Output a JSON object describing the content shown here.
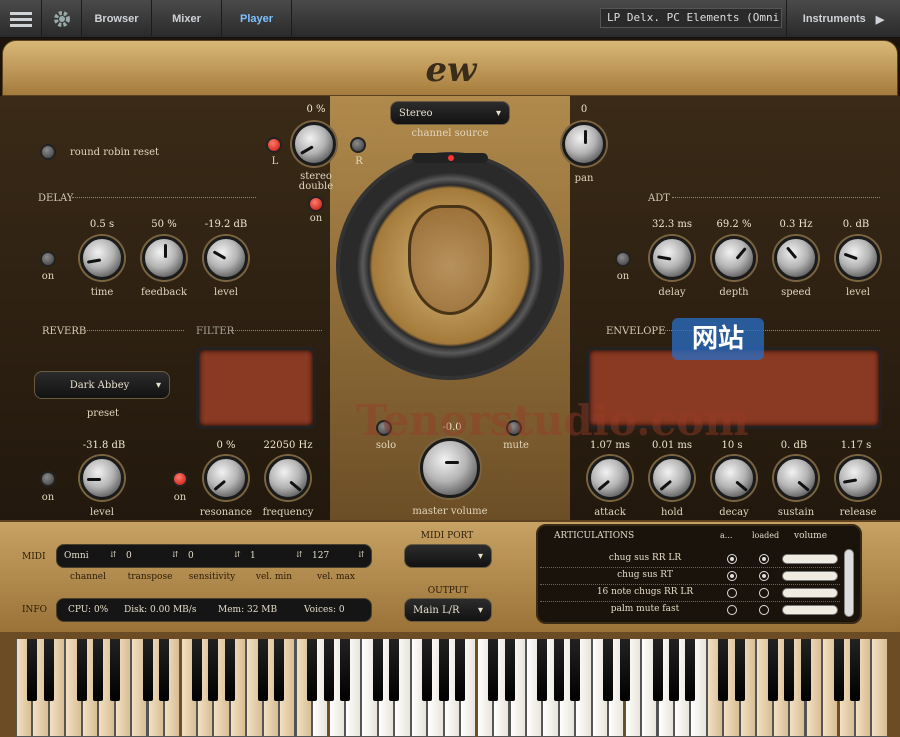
{
  "topbar": {
    "tabs": [
      "Browser",
      "Mixer",
      "Player"
    ],
    "active_tab": "Player",
    "preset": "LP Delx. PC Elements (Omni)",
    "instruments_label": "Instruments"
  },
  "brand": "ew",
  "round_robin": {
    "label": "round robin reset"
  },
  "stereo_double": {
    "value": "0 %",
    "label": "stereo double",
    "left": "L",
    "right": "R",
    "on_label": "on"
  },
  "channel_source": {
    "value": "Stereo",
    "label": "channel source"
  },
  "pan": {
    "value": "0",
    "label": "pan"
  },
  "delay": {
    "title": "DELAY",
    "on_label": "on",
    "knobs": [
      {
        "value": "0.5 s",
        "label": "time"
      },
      {
        "value": "50 %",
        "label": "feedback"
      },
      {
        "value": "-19.2 dB",
        "label": "level"
      }
    ]
  },
  "adt": {
    "title": "ADT",
    "on_label": "on",
    "knobs": [
      {
        "value": "32.3 ms",
        "label": "delay"
      },
      {
        "value": "69.2 %",
        "label": "depth"
      },
      {
        "value": "0.3 Hz",
        "label": "speed"
      },
      {
        "value": "0. dB",
        "label": "level"
      }
    ]
  },
  "reverb": {
    "title": "REVERB",
    "preset": "Dark Abbey",
    "preset_label": "preset",
    "value": "-31.8 dB",
    "label": "level",
    "on_label": "on"
  },
  "filter": {
    "title": "FILTER",
    "on_label": "on",
    "knobs": [
      {
        "value": "0 %",
        "label": "resonance"
      },
      {
        "value": "22050 Hz",
        "label": "frequency"
      }
    ]
  },
  "center": {
    "solo": "solo",
    "mute": "mute",
    "master_value": "-0.0",
    "master_label": "master volume"
  },
  "envelope": {
    "title": "ENVELOPE",
    "knobs": [
      {
        "value": "1.07 ms",
        "label": "attack"
      },
      {
        "value": "0.01 ms",
        "label": "hold"
      },
      {
        "value": "10 s",
        "label": "decay"
      },
      {
        "value": "0. dB",
        "label": "sustain"
      },
      {
        "value": "1.17 s",
        "label": "release"
      }
    ]
  },
  "midi": {
    "title": "MIDI",
    "fields": [
      {
        "value": "Omni",
        "label": "channel"
      },
      {
        "value": "0",
        "label": "transpose"
      },
      {
        "value": "0",
        "label": "sensitivity"
      },
      {
        "value": "1",
        "label": "vel. min"
      },
      {
        "value": "127",
        "label": "vel. max"
      }
    ]
  },
  "info": {
    "title": "INFO",
    "cpu": "CPU: 0%",
    "disk": "Disk: 0.00 MB/s",
    "mem": "Mem: 32 MB",
    "voices": "Voices: 0"
  },
  "midi_port": {
    "label": "MIDI PORT",
    "value": ""
  },
  "output": {
    "label": "OUTPUT",
    "value": "Main L/R"
  },
  "articulations": {
    "title": "ARTICULATIONS",
    "col_a": "a...",
    "col_loaded": "loaded",
    "col_volume": "volume",
    "rows": [
      {
        "name": "chug sus RR LR",
        "active": true,
        "loaded": true
      },
      {
        "name": "chug sus RT",
        "active": true,
        "loaded": true
      },
      {
        "name": "16 note chugs RR LR",
        "active": false,
        "loaded": false
      },
      {
        "name": "palm mute fast",
        "active": false,
        "loaded": false
      }
    ]
  },
  "watermark": {
    "text": "Tenorstudio.com",
    "badge": "网站"
  }
}
